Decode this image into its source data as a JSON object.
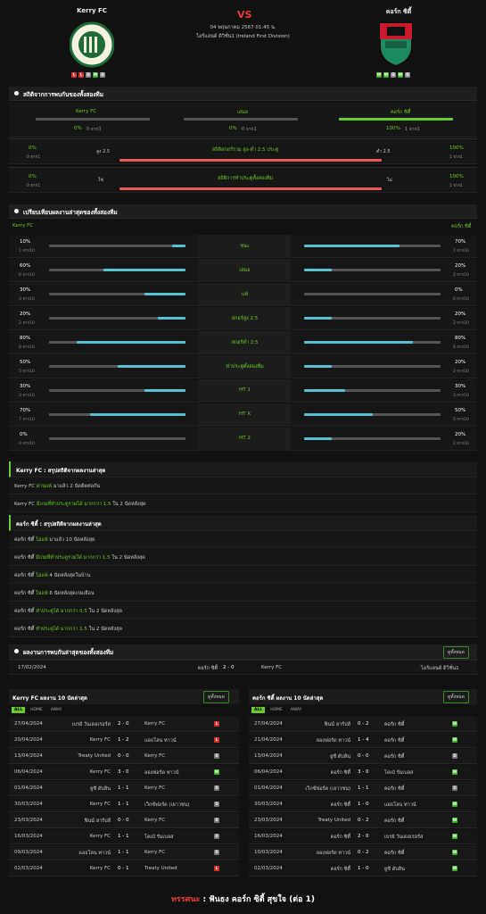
{
  "header": {
    "home": "Kerry FC",
    "away": "คอร์ก ซิตี้",
    "vs": "VS",
    "datetime": "04 พฤษภาคม 2567 01:45 น.",
    "league": "ไอร์แลนด์ ดิวิชั่น1 (Ireland First Division)",
    "home_form": [
      "L",
      "L",
      "D",
      "W",
      "D"
    ],
    "away_form": [
      "W",
      "W",
      "D",
      "W",
      "D"
    ]
  },
  "h2h": {
    "title": "สถิติจากการพบกันของทั้งสองทีม",
    "home_label": "Kerry FC",
    "draw_label": "เสมอ",
    "away_label": "คอร์ก ซิตี้",
    "home_pct": "0%",
    "home_sub": "0 จาก1",
    "draw_pct": "0%",
    "draw_sub": "0 จาก1",
    "away_pct": "100%",
    "away_sub": "1 จาก1",
    "home_val": 0,
    "draw_val": 0,
    "away_val": 1,
    "ou": {
      "left_pct": "0%",
      "left_sub": "0 จาก1",
      "left_lbl": "สูง 2.5",
      "center": "สถิติสกอร์รวม สูง-ต่ำ 2.5 ประตู",
      "right_lbl": "ต่ำ 2.5",
      "right_pct": "100%",
      "right_sub": "1 จาก1",
      "value": 0
    },
    "btts": {
      "left_pct": "0%",
      "left_sub": "0 จาก1",
      "left_lbl": "ใช่",
      "center": "สถิติการทำประตูทั้งสองทีม",
      "right_lbl": "ไม่",
      "right_pct": "100%",
      "right_sub": "1 จาก1",
      "value": 0
    }
  },
  "compare": {
    "title": "เปรียบเทียบผลงานล่าสุดของทั้งสองทีม",
    "home": "Kerry FC",
    "away": "คอร์ก ซิตี้",
    "rows": [
      {
        "label": "ชนะ",
        "hp": "10%",
        "hs": "1 จาก10",
        "hv": 0.1,
        "ap": "70%",
        "as": "7 จาก10",
        "av": 0.7
      },
      {
        "label": "เสมอ",
        "hp": "60%",
        "hs": "6 จาก10",
        "hv": 0.6,
        "ap": "20%",
        "as": "2 จาก10",
        "av": 0.2
      },
      {
        "label": "แพ้",
        "hp": "30%",
        "hs": "3 จาก10",
        "hv": 0.3,
        "ap": "0%",
        "as": "0 จาก10",
        "av": 0
      },
      {
        "label": "สกอร์สูง 2.5",
        "hp": "20%",
        "hs": "2 จาก10",
        "hv": 0.2,
        "ap": "20%",
        "as": "2 จาก10",
        "av": 0.2
      },
      {
        "label": "สกอร์ต่ำ 2.5",
        "hp": "80%",
        "hs": "8 จาก10",
        "hv": 0.8,
        "ap": "80%",
        "as": "8 จาก10",
        "av": 0.8
      },
      {
        "label": "ทำประตูทั้งสองทีม",
        "hp": "50%",
        "hs": "5 จาก10",
        "hv": 0.5,
        "ap": "20%",
        "as": "2 จาก10",
        "av": 0.2
      },
      {
        "label": "HT 1",
        "hp": "30%",
        "hs": "3 จาก10",
        "hv": 0.3,
        "ap": "30%",
        "as": "3 จาก10",
        "av": 0.3
      },
      {
        "label": "HT X",
        "hp": "70%",
        "hs": "7 จาก10",
        "hv": 0.7,
        "ap": "50%",
        "as": "5 จาก10",
        "av": 0.5
      },
      {
        "label": "HT 2",
        "hp": "0%",
        "hs": "0 จาก10",
        "hv": 0,
        "ap": "20%",
        "as": "2 จาก10",
        "av": 0.2
      }
    ]
  },
  "home_summary": {
    "title": "Kerry FC : สรุปสถิติจากผลงานล่าสุด",
    "lines": [
      {
        "a": "Kerry FC",
        "b": "ผ่านแพ้",
        "c": "มาแล้ว 2 นัดติดต่อกัน"
      },
      {
        "a": "Kerry FC",
        "b": "มีเกมที่ทำประตูรวมได้",
        "c": "มากกว่า 1.5",
        "d": "ใน 2 นัดหลังสุด"
      }
    ]
  },
  "away_summary": {
    "title": "คอร์ก ซิตี้ : สรุปสถิติจากผลงานล่าสุด",
    "lines": [
      {
        "a": "คอร์ก ซิตี้",
        "b": "ไม่แพ้",
        "c": "มาแล้ว 10 นัดหลังสุด"
      },
      {
        "a": "คอร์ก ซิตี้",
        "b": "มีเกมที่ทำประตูรวมได้",
        "c": "มากกว่า 1.5",
        "d": "ใน 2 นัดหลังสุด"
      },
      {
        "a": "คอร์ก ซิตี้",
        "b": "ไม่แพ้",
        "c": "4 นัดหลังสุดในบ้าน"
      },
      {
        "a": "คอร์ก ซิตี้",
        "b": "ไม่แพ้",
        "c": "6 นัดหลังสุดเกมเยือน"
      },
      {
        "a": "คอร์ก ซิตี้",
        "b": "ทำประตูได้",
        "c": "มากกว่า 0.5",
        "d": "ใน 2 นัดหลังสุด"
      },
      {
        "a": "คอร์ก ซิตี้",
        "b": "ทำประตูได้",
        "c": "มากกว่า 1.5",
        "d": "ใน 2 นัดหลังสุด"
      }
    ]
  },
  "h2h_results": {
    "title": "ผลงานการพบกันล่าสุดของทั้งสองทีม",
    "button": "ดูทั้งหมด",
    "rows": [
      {
        "date": "17/02/2024",
        "home": "คอร์ก ซิตี้",
        "score": "2 - 0",
        "away": "Kerry FC",
        "league": "ไอร์แลนด์ ดิวิชั่น1"
      }
    ]
  },
  "home_last10": {
    "title": "Kerry FC ผลงาน 10 นัดล่าสุด",
    "button": "ดูทั้งหมด",
    "tabs": [
      "ALL",
      "HOME",
      "AWAY"
    ],
    "rows": [
      {
        "date": "27/04/2024",
        "home": "เบรย์ วันเดอเรอร์ส",
        "score": "2 - 0",
        "away": "Kerry FC",
        "r": "L"
      },
      {
        "date": "20/04/2024",
        "home": "Kerry FC",
        "score": "1 - 2",
        "away": "แอธโลน ทาวน์",
        "r": "L"
      },
      {
        "date": "13/04/2024",
        "home": "Treaty United",
        "score": "0 - 0",
        "away": "Kerry FC",
        "r": "D"
      },
      {
        "date": "06/04/2024",
        "home": "Kerry FC",
        "score": "3 - 0",
        "away": "ลองฟอร์ด ทาวน์",
        "r": "W"
      },
      {
        "date": "01/04/2024",
        "home": "ยูซี ดับลิน",
        "score": "1 - 1",
        "away": "Kerry FC",
        "r": "D"
      },
      {
        "date": "30/03/2024",
        "home": "Kerry FC",
        "score": "1 - 1",
        "away": "เว็กซ์ฟอร์ด (เยาวชน)",
        "r": "D"
      },
      {
        "date": "23/03/2024",
        "home": "ฟินน์ ฮาร์ปส์",
        "score": "0 - 0",
        "away": "Kerry FC",
        "r": "D"
      },
      {
        "date": "16/03/2024",
        "home": "Kerry FC",
        "score": "1 - 1",
        "away": "โคเบ้ รัมเบลส",
        "r": "D"
      },
      {
        "date": "09/03/2024",
        "home": "แอธโลน ทาวน์",
        "score": "1 - 1",
        "away": "Kerry FC",
        "r": "D"
      },
      {
        "date": "02/03/2024",
        "home": "Kerry FC",
        "score": "0 - 1",
        "away": "Treaty United",
        "r": "L"
      }
    ]
  },
  "away_last10": {
    "title": "คอร์ก ซิตี้ ผลงาน 10 นัดล่าสุด",
    "button": "ดูทั้งหมด",
    "tabs": [
      "ALL",
      "HOME",
      "AWAY"
    ],
    "rows": [
      {
        "date": "27/04/2024",
        "home": "ฟินน์ ฮาร์ปส์",
        "score": "0 - 2",
        "away": "คอร์ก ซิตี้",
        "r": "W"
      },
      {
        "date": "21/04/2024",
        "home": "ลองฟอร์ด ทาวน์",
        "score": "1 - 4",
        "away": "คอร์ก ซิตี้",
        "r": "W"
      },
      {
        "date": "13/04/2024",
        "home": "ยูซี ดับลิน",
        "score": "0 - 0",
        "away": "คอร์ก ซิตี้",
        "r": "D"
      },
      {
        "date": "06/04/2024",
        "home": "คอร์ก ซิตี้",
        "score": "3 - 0",
        "away": "โคเบ้ รัมเบลส",
        "r": "W"
      },
      {
        "date": "01/04/2024",
        "home": "เว็กซ์ฟอร์ด (เยาวชน)",
        "score": "1 - 1",
        "away": "คอร์ก ซิตี้",
        "r": "D"
      },
      {
        "date": "30/03/2024",
        "home": "คอร์ก ซิตี้",
        "score": "1 - 0",
        "away": "แอธโลน ทาวน์",
        "r": "W"
      },
      {
        "date": "23/03/2024",
        "home": "Treaty United",
        "score": "0 - 2",
        "away": "คอร์ก ซิตี้",
        "r": "W"
      },
      {
        "date": "16/03/2024",
        "home": "คอร์ก ซิตี้",
        "score": "2 - 0",
        "away": "เบรย์ วันเดอเรอร์ส",
        "r": "W"
      },
      {
        "date": "10/03/2024",
        "home": "ลองฟอร์ด ทาวน์",
        "score": "0 - 2",
        "away": "คอร์ก ซิตี้",
        "r": "W"
      },
      {
        "date": "02/03/2024",
        "home": "คอร์ก ซิตี้",
        "score": "1 - 0",
        "away": "ยูซี ดับลิน",
        "r": "W"
      }
    ]
  },
  "verdict": {
    "label": "ทรรศนะ",
    "sep": ":",
    "text": "ฟันธง คอร์ก ซิตี้ สุขใจ (ต่อ 1)"
  },
  "colors": {
    "green": "#6ccd2a",
    "red": "#e85a5a",
    "teal": "#5bc0d0"
  }
}
